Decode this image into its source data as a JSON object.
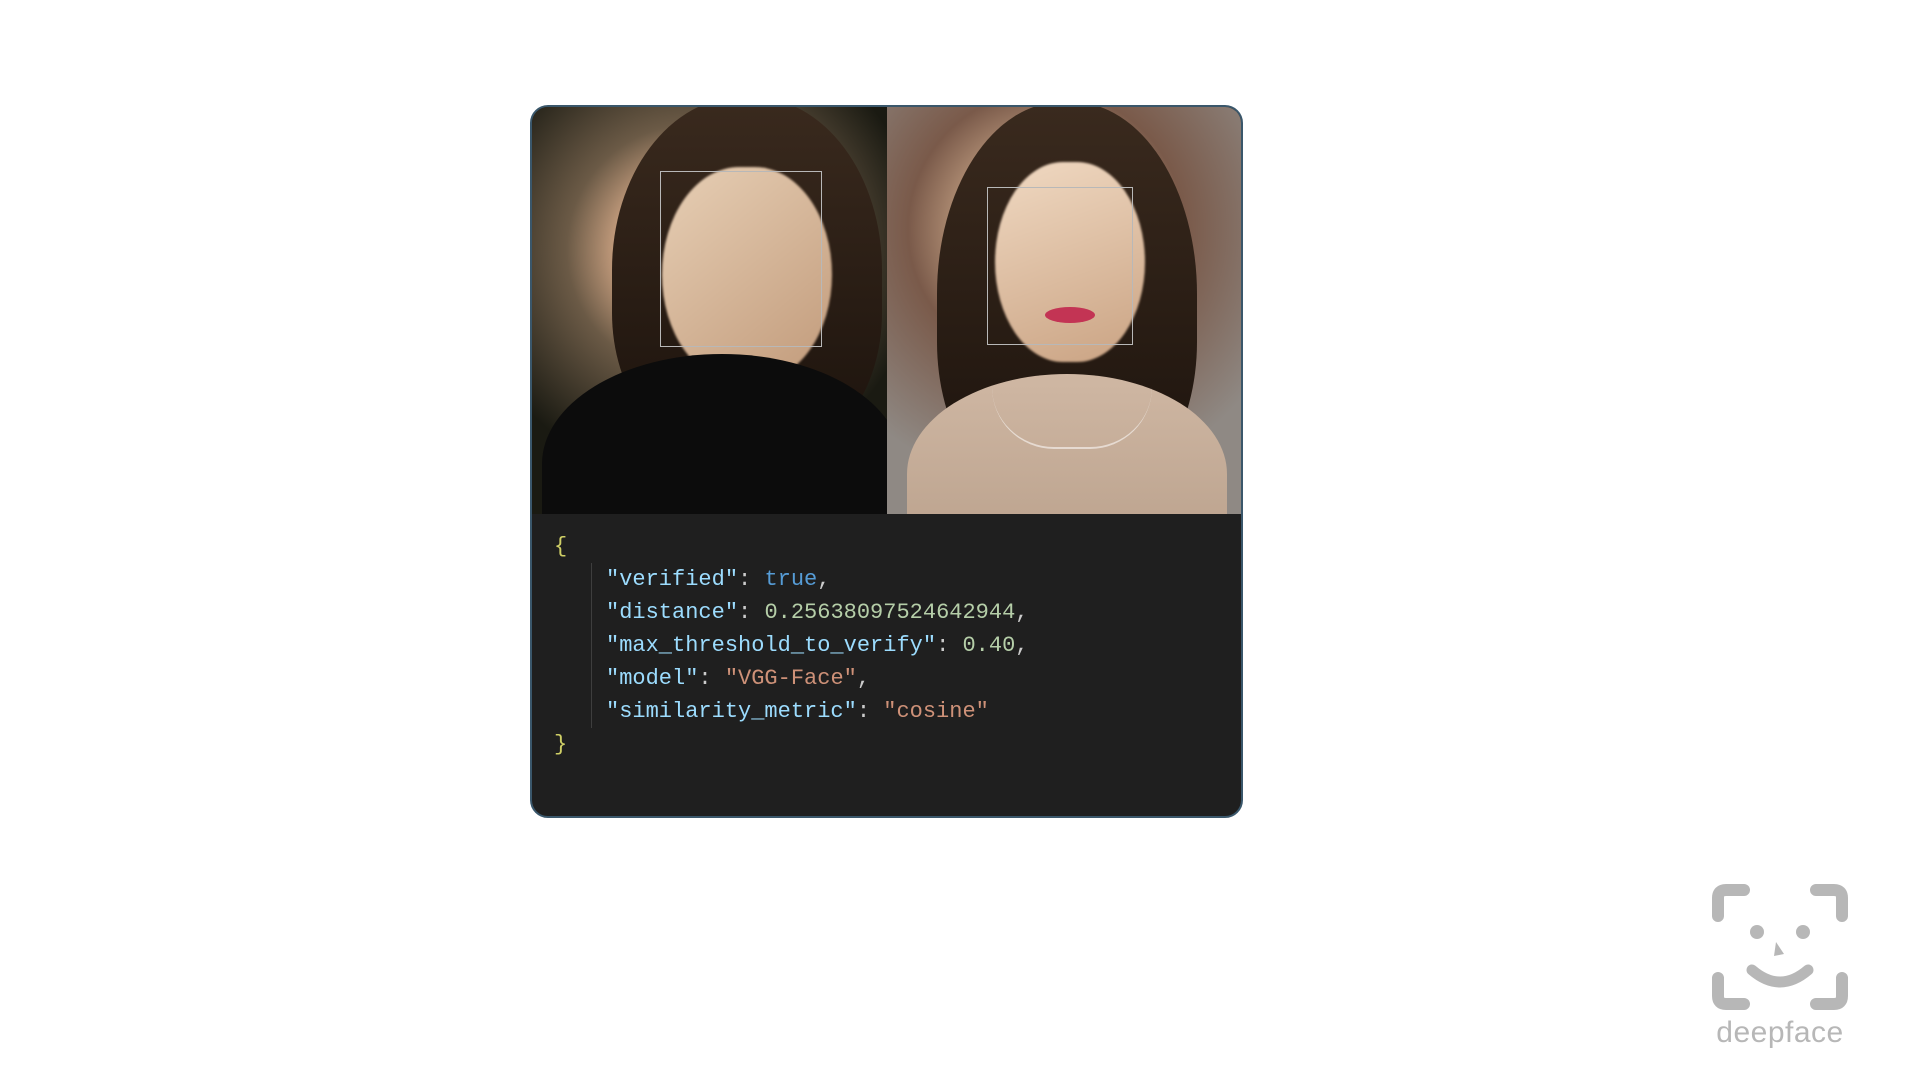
{
  "result": {
    "verified": {
      "key": "\"verified\"",
      "value": "true"
    },
    "distance": {
      "key": "\"distance\"",
      "value": "0.25638097524642944"
    },
    "max_threshold_to_verify": {
      "key": "\"max_threshold_to_verify\"",
      "value": "0.40"
    },
    "model": {
      "key": "\"model\"",
      "value": "\"VGG-Face\""
    },
    "similarity_metric": {
      "key": "\"similarity_metric\"",
      "value": "\"cosine\""
    }
  },
  "braces": {
    "open": "{",
    "close": "}"
  },
  "punct": {
    "colon": ": ",
    "comma": ","
  },
  "logo": {
    "text": "deepface"
  }
}
